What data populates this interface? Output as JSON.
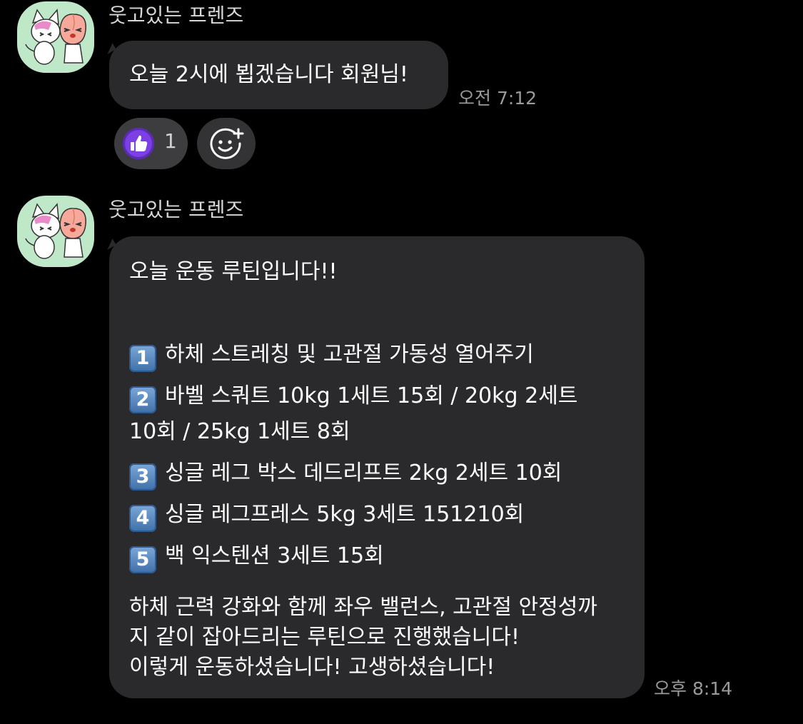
{
  "messages": [
    {
      "sender": "웃고있는 프렌즈",
      "text": "오늘 2시에 뵙겠습니다 회원님!",
      "time": "오전 7:12",
      "reactions": {
        "like_icon": "thumbs-up-icon",
        "like_count": "1",
        "add_icon": "add-reaction-icon"
      }
    },
    {
      "sender": "웃고있는 프렌즈",
      "intro": "오늘 운동 루틴입니다!!",
      "items": [
        {
          "num": "1",
          "text": "하체 스트레칭 및 고관절 가동성 열어주기"
        },
        {
          "num": "2",
          "text": "바벨 스쿼트 10kg 1세트 15회 / 20kg 2세트",
          "cont": "10회 / 25kg 1세트 8회"
        },
        {
          "num": "3",
          "text": "싱글 레그 박스 데드리프트 2kg 2세트 10회"
        },
        {
          "num": "4",
          "text": "싱글 레그프레스 5kg 3세트 151210회"
        },
        {
          "num": "5",
          "text": "백 익스텐션 3세트 15회"
        }
      ],
      "outro": [
        "하체 근력 강화와 함께 좌우 밸런스, 고관절 안정성까",
        "지 같이 잡아드리는 루틴으로 진행했습니다!",
        "이렇게 운동하셨습니다! 고생하셨습니다!"
      ],
      "time": "오후 8:14"
    }
  ],
  "avatar": {
    "icon": "friends-cat-peach-avatar-icon"
  },
  "colors": {
    "background": "#000000",
    "bubble": "#2a2a2c",
    "like_accent": "#7b3fe4",
    "avatar_bg": "#bfe8c8",
    "keycap": "#5b8fc9"
  }
}
